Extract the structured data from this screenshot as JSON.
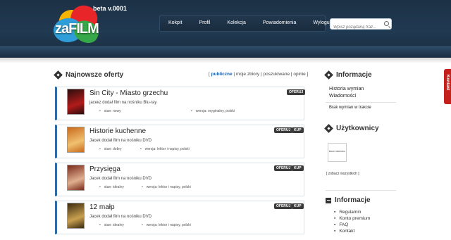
{
  "header": {
    "logo_text": "zaFILM",
    "beta": "beta v.0001",
    "nav": [
      "Kokpit",
      "Profil",
      "Kolekcja",
      "Powiadomienia",
      "Wyloguj"
    ],
    "search_placeholder": "Wpisz pożądaną fraz..."
  },
  "main": {
    "title": "Najnowsze oferty",
    "filters": {
      "open": "[",
      "items": [
        "publiczne",
        "moje zbiory",
        "poszukiwane",
        "opinie"
      ],
      "sep": "|",
      "close": "]"
    },
    "offers": [
      {
        "title": "Sin City - Miasto grzechu",
        "desc": "jaceкz dodał film na nośniku Blu-ray",
        "stan": "stan: nowy",
        "wersja": "wersja: oryginalny, polski",
        "badges": [
          "OFERUJ"
        ],
        "cover_colors": [
          "#2a0d0d",
          "#b21b1b"
        ]
      },
      {
        "title": "Historie kuchenne",
        "desc": "Jacek dodał film na nośniku DVD",
        "stan": "stan: dobry",
        "wersja": "wersja: lektor i napisy, polski",
        "badges": [
          "OFERUJ",
          "KUP"
        ],
        "cover_colors": [
          "#c96a1c",
          "#f0c070"
        ]
      },
      {
        "title": "Przysięga",
        "desc": "Jacek dodał film na nośniku DVD",
        "stan": "stan: idealny",
        "wersja": "wersja: lektor i napisy, polski",
        "badges": [
          "OFERUJ",
          "KUP"
        ],
        "cover_colors": [
          "#7a2a1a",
          "#e0b090"
        ]
      },
      {
        "title": "12 małp",
        "desc": "Jacek dodał film na nośniku DVD",
        "stan": "stan: idealny",
        "wersja": "wersja: lektor i napisy, polski",
        "badges": [
          "OFERUJ",
          "KUP"
        ],
        "cover_colors": [
          "#3a2a10",
          "#c9a050"
        ]
      }
    ]
  },
  "sidebar": {
    "info_title": "Informacje",
    "info_links": [
      "Historia wymian",
      "Wiadomości"
    ],
    "no_trades": "Brak wymian w trakcie",
    "users_title": "Użytkownicy",
    "avatar_text": "BRAK OBRAZKA",
    "see_all": "[ zobacz wszystkich ]",
    "info2_title": "Informacje",
    "info2_items": [
      "Regulamin",
      "Konto premium",
      "FAQ",
      "Kontakt"
    ]
  },
  "kontakt_tab": "Kontakt",
  "colors": {
    "header_bg": "#1d3145",
    "accent_blue": "#2e6da4",
    "kontakt_red": "#c4201c",
    "badge_dark": "#3b3b3b"
  }
}
